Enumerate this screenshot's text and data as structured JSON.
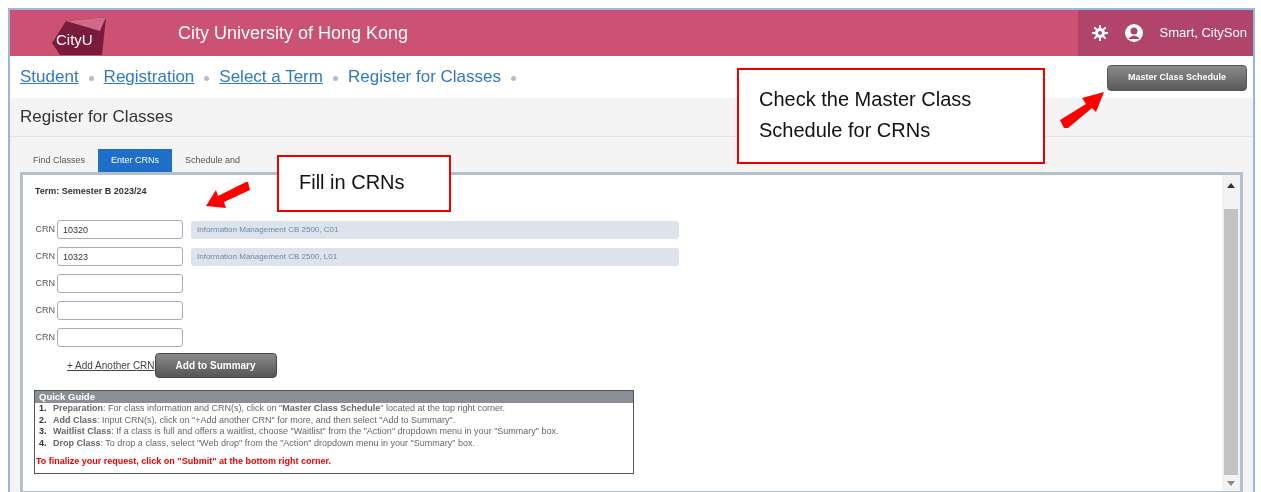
{
  "header": {
    "logo": "CityU",
    "title": "City University of Hong Kong",
    "user": "Smart, CitySon"
  },
  "breadcrumbs": [
    {
      "label": "Student",
      "link": true
    },
    {
      "label": "Registration",
      "link": true
    },
    {
      "label": "Select a Term",
      "link": true
    },
    {
      "label": "Register for Classes",
      "link": false
    }
  ],
  "master_button": "Master Class Schedule",
  "page_title": "Register for Classes",
  "tabs": [
    {
      "label": "Find Classes",
      "selected": false
    },
    {
      "label": "Enter CRNs",
      "selected": true
    },
    {
      "label": "Schedule and",
      "selected": false
    }
  ],
  "term": "Term: Semester B 2023/24",
  "crn_rows": [
    {
      "label": "CRN",
      "value": "10320",
      "course": "Information Management CB 2500, C01"
    },
    {
      "label": "CRN",
      "value": "10323",
      "course": "Information Management CB 2500, L01"
    },
    {
      "label": "CRN"
    },
    {
      "label": "CRN"
    },
    {
      "label": "CRN"
    }
  ],
  "add_link": "+ Add Another CRN",
  "add_button": "Add to Summary",
  "quick_guide": {
    "title": "Quick Guide",
    "items": [
      {
        "number": "1.",
        "text": "**Preparation**: For class information and CRN(s), click on \"**Master Class Schedule**\" located at the top right corner."
      },
      {
        "number": "2.",
        "text": "**Add Class**: Input CRN(s), click on \"+Add another CRN\" for more, and then select \"Add to Summary\"."
      },
      {
        "number": "3.",
        "text": "**Waitlist Class**: If a class is full and offers a waitlist, choose \"Waitlist\" from the \"Action\" dropdown menu in your \"Summary\" box."
      },
      {
        "number": "4.",
        "text": "**Drop Class**: To drop a class, select \"Web drop\" from the \"Action\" dropdown menu in your \"Summary\" box."
      }
    ],
    "note": "To finalize your request, click on \"Submit\" at the bottom right corner."
  },
  "callouts": [
    {
      "text": "Fill in CRNs"
    },
    {
      "text": "Check the Master Class Schedule for CRNs"
    }
  ]
}
